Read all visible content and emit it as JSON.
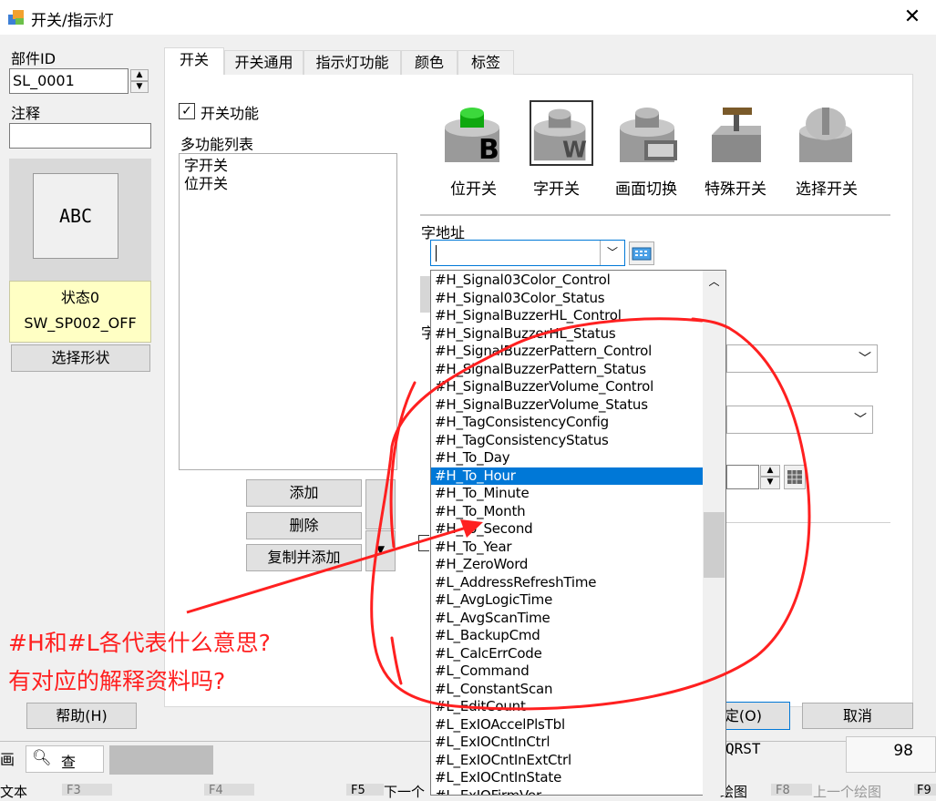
{
  "window": {
    "title": "开关/指示灯",
    "close_glyph": "✕"
  },
  "left": {
    "part_id_label": "部件ID",
    "part_id_value": "SL_0001",
    "comment_label": "注释",
    "comment_value": "",
    "preview_text": "ABC",
    "state_line1": "状态0",
    "state_line2": "SW_SP002_OFF",
    "select_shape_button": "选择形状",
    "help_button": "帮助(H)"
  },
  "tabs": [
    {
      "label": "开关",
      "active": true
    },
    {
      "label": "开关通用",
      "active": false
    },
    {
      "label": "指示灯功能",
      "active": false
    },
    {
      "label": "颜色",
      "active": false
    },
    {
      "label": "标签",
      "active": false
    }
  ],
  "switch_panel": {
    "switch_function_label": "开关功能",
    "switch_function_checked": true,
    "multi_function_list_label": "多功能列表",
    "multi_function_list": [
      "字开关",
      "位开关"
    ],
    "add_button": "添加",
    "delete_button": "删除",
    "copy_add_button": "复制并添加",
    "switch_types": [
      {
        "label": "位开关",
        "icon": "bit-switch-icon"
      },
      {
        "label": "字开关",
        "icon": "word-switch-icon"
      },
      {
        "label": "画面切换",
        "icon": "screen-change-icon"
      },
      {
        "label": "特殊开关",
        "icon": "special-switch-icon"
      },
      {
        "label": "选择开关",
        "icon": "selector-switch-icon"
      }
    ],
    "word_address_label": "字地址",
    "word_address_value": "",
    "partial_label": "字"
  },
  "dropdown": {
    "selected": "#H_To_Hour",
    "items": [
      "#H_Signal03Color_Control",
      "#H_Signal03Color_Status",
      "#H_SignalBuzzerHL_Control",
      "#H_SignalBuzzerHL_Status",
      "#H_SignalBuzzerPattern_Control",
      "#H_SignalBuzzerPattern_Status",
      "#H_SignalBuzzerVolume_Control",
      "#H_SignalBuzzerVolume_Status",
      "#H_TagConsistencyConfig",
      "#H_TagConsistencyStatus",
      "#H_To_Day",
      "#H_To_Hour",
      "#H_To_Minute",
      "#H_To_Month",
      "#H_To_Second",
      "#H_To_Year",
      "#H_ZeroWord",
      "#L_AddressRefreshTime",
      "#L_AvgLogicTime",
      "#L_AvgScanTime",
      "#L_BackupCmd",
      "#L_CalcErrCode",
      "#L_Command",
      "#L_ConstantScan",
      "#L_EditCount",
      "#L_ExIOAccelPlsTbl",
      "#L_ExIOCntInCtrl",
      "#L_ExIOCntInExtCtrl",
      "#L_ExIOCntInState",
      "#L_ExIOFirmVer"
    ]
  },
  "bottom": {
    "ok_button": "确定(O)",
    "cancel_button": "取消"
  },
  "taskbar": {
    "item1": "画",
    "item2": "查",
    "text_qrst": "QRST",
    "num98": "98",
    "text_label": "文本",
    "f3": "F3",
    "f4": "F4",
    "f5": "F5",
    "next_label": "下一个",
    "draw_label": "绘图",
    "f8": "F8",
    "prev_draw": "上一个绘图",
    "f9": "F9"
  },
  "annotation": {
    "line1": "#H和#L各代表什么意思?",
    "line2": "有对应的解释资料吗?",
    "color": "#ff2020"
  }
}
